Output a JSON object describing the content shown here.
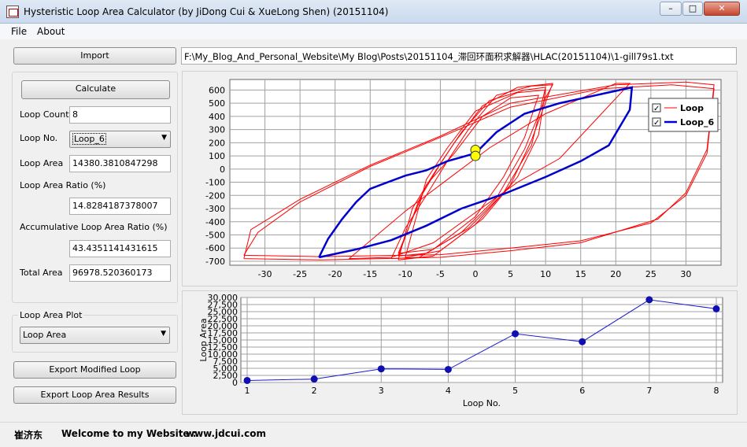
{
  "window": {
    "title": "Hysteristic Loop Area Calculator (by JiDong Cui & XueLong Shen) (20151104)",
    "controls": {
      "minimize": "–",
      "maximize": "□",
      "close": "✕"
    }
  },
  "menu": {
    "file": "File",
    "about": "About"
  },
  "import": {
    "button": "Import",
    "path": "F:\\My_Blog_And_Personal_Website\\My Blog\\Posts\\20151104_滞回环面积求解器\\HLAC(20151104)\\1-gill79s1.txt"
  },
  "calc": {
    "button": "Calculate",
    "loop_count_label": "Loop Count",
    "loop_count": "8",
    "loop_no_label": "Loop No.",
    "loop_no": "Loop_6",
    "loop_area_label": "Loop Area",
    "loop_area": "14380.3810847298",
    "loop_area_ratio_label": "Loop Area Ratio (%)",
    "loop_area_ratio": "14.8284187378007",
    "accum_label": "Accumulative Loop Area Ratio (%)",
    "accum": "43.4351141431615",
    "total_area_label": "Total Area",
    "total_area": "96978.520360173"
  },
  "plot_select": {
    "group_label": "Loop Area Plot",
    "selected": "Loop Area"
  },
  "buttons": {
    "export_loop": "Export Modified Loop",
    "export_results": "Export Loop Area Results"
  },
  "status": {
    "name": "崔济东",
    "welcome": "Welcome to my Website :",
    "site": "www.jdcui.com"
  },
  "colors": {
    "loop": "#ff0000",
    "selected_loop": "#0000cc",
    "marker": "#ffff00",
    "bar_series": "#1a1acc"
  },
  "chart_data": [
    {
      "type": "line",
      "x_ticks": [
        -30,
        -25,
        -20,
        -15,
        -10,
        -5,
        0,
        5,
        10,
        15,
        20,
        25,
        30
      ],
      "y_ticks": [
        600,
        500,
        400,
        300,
        200,
        100,
        0,
        -100,
        -200,
        -300,
        -400,
        -500,
        -600,
        -700
      ],
      "xlim": [
        -35,
        35
      ],
      "ylim": [
        -730,
        680
      ],
      "grid": true,
      "legend_placement": "top-right",
      "series": [
        {
          "name": "Loop",
          "color": "#ff0000",
          "loops": [
            [
              [
                -33,
                -680
              ],
              [
                -22,
                -690
              ],
              [
                -5,
                -670
              ],
              [
                5,
                -620
              ],
              [
                15,
                -560
              ],
              [
                26,
                -380
              ],
              [
                30,
                -180
              ],
              [
                33,
                150
              ],
              [
                34,
                640
              ],
              [
                30,
                660
              ],
              [
                20,
                640
              ],
              [
                5,
                500
              ],
              [
                -5,
                250
              ],
              [
                -15,
                30
              ],
              [
                -25,
                -230
              ],
              [
                -32,
                -460
              ],
              [
                -33,
                -680
              ]
            ],
            [
              [
                -33,
                -655
              ],
              [
                -22,
                -665
              ],
              [
                -5,
                -650
              ],
              [
                5,
                -600
              ],
              [
                15,
                -545
              ],
              [
                25,
                -410
              ],
              [
                30,
                -200
              ],
              [
                33,
                120
              ],
              [
                34,
                610
              ],
              [
                28,
                640
              ],
              [
                18,
                610
              ],
              [
                5,
                470
              ],
              [
                -5,
                240
              ],
              [
                -15,
                20
              ],
              [
                -25,
                -250
              ],
              [
                -31,
                -480
              ],
              [
                -33,
                -655
              ]
            ],
            [
              [
                -12,
                -680
              ],
              [
                -8,
                -670
              ],
              [
                -2,
                -480
              ],
              [
                3,
                -220
              ],
              [
                7,
                150
              ],
              [
                10,
                540
              ],
              [
                11,
                640
              ],
              [
                8,
                630
              ],
              [
                3,
                560
              ],
              [
                -1,
                300
              ],
              [
                -4,
                60
              ],
              [
                -7,
                -200
              ],
              [
                -10,
                -450
              ],
              [
                -12,
                -680
              ]
            ],
            [
              [
                -11,
                -660
              ],
              [
                -7,
                -640
              ],
              [
                -1,
                -450
              ],
              [
                4,
                -180
              ],
              [
                8,
                180
              ],
              [
                10,
                620
              ],
              [
                7,
                600
              ],
              [
                2,
                520
              ],
              [
                -2,
                280
              ],
              [
                -5,
                40
              ],
              [
                -8,
                -230
              ],
              [
                -11,
                -660
              ]
            ],
            [
              [
                -11,
                -690
              ],
              [
                -6,
                -660
              ],
              [
                0,
                -420
              ],
              [
                5,
                -120
              ],
              [
                8,
                220
              ],
              [
                11,
                650
              ],
              [
                6,
                620
              ],
              [
                1,
                480
              ],
              [
                -3,
                200
              ],
              [
                -6,
                -40
              ],
              [
                -9,
                -300
              ],
              [
                -11,
                -690
              ]
            ],
            [
              [
                -10,
                -670
              ],
              [
                -5,
                -620
              ],
              [
                1,
                -380
              ],
              [
                6,
                -60
              ],
              [
                9,
                260
              ],
              [
                10,
                600
              ],
              [
                6,
                580
              ],
              [
                0,
                440
              ],
              [
                -4,
                160
              ],
              [
                -7,
                -80
              ],
              [
                -10,
                -670
              ]
            ],
            [
              [
                -11,
                -640
              ],
              [
                -6,
                -610
              ],
              [
                0,
                -360
              ],
              [
                4,
                -60
              ],
              [
                7,
                240
              ],
              [
                9,
                560
              ],
              [
                5,
                540
              ],
              [
                1,
                400
              ],
              [
                -3,
                120
              ],
              [
                -7,
                -120
              ],
              [
                -11,
                -640
              ]
            ],
            [
              [
                -18,
                -680
              ],
              [
                -12,
                -670
              ],
              [
                -6,
                -560
              ],
              [
                0,
                -330
              ],
              [
                6,
                -100
              ],
              [
                12,
                80
              ],
              [
                22,
                650
              ],
              [
                20,
                650
              ],
              [
                10,
                420
              ],
              [
                2,
                160
              ],
              [
                -4,
                -80
              ],
              [
                -10,
                -320
              ],
              [
                -18,
                -680
              ]
            ]
          ]
        },
        {
          "name": "Loop_6",
          "color": "#0000cc",
          "points": [
            [
              -22.3,
              -670
            ],
            [
              -17,
              -610
            ],
            [
              -12,
              -540
            ],
            [
              -7,
              -430
            ],
            [
              -2,
              -300
            ],
            [
              4,
              -190
            ],
            [
              10,
              -60
            ],
            [
              15,
              60
            ],
            [
              19,
              180
            ],
            [
              22,
              450
            ],
            [
              22.3,
              620
            ],
            [
              18,
              570
            ],
            [
              12,
              500
            ],
            [
              7,
              420
            ],
            [
              3,
              280
            ],
            [
              0,
              120
            ],
            [
              -4,
              60
            ],
            [
              -7,
              -10
            ],
            [
              -10,
              -50
            ],
            [
              -13,
              -110
            ],
            [
              -15,
              -150
            ],
            [
              -17,
              -250
            ],
            [
              -19,
              -380
            ],
            [
              -21,
              -530
            ],
            [
              -22.3,
              -670
            ]
          ]
        }
      ],
      "markers": [
        [
          0,
          145
        ],
        [
          0,
          100
        ]
      ]
    },
    {
      "type": "line",
      "xlabel": "Loop No.",
      "ylabel": "Loop Area",
      "x": [
        1,
        2,
        3,
        4,
        5,
        6,
        7,
        8
      ],
      "values": [
        700,
        1200,
        4800,
        4600,
        17200,
        14380,
        29200,
        26000
      ],
      "xlim": [
        1,
        8
      ],
      "ylim": [
        0,
        30000
      ],
      "y_ticks": [
        "0",
        "2,500",
        "5,000",
        "7,500",
        "10,000",
        "12,500",
        "15,000",
        "17,500",
        "20,000",
        "22,500",
        "25,000",
        "27,500",
        "30,000"
      ],
      "x_ticks": [
        "1",
        "2",
        "3",
        "4",
        "5",
        "6",
        "7",
        "8"
      ],
      "grid": true
    }
  ]
}
